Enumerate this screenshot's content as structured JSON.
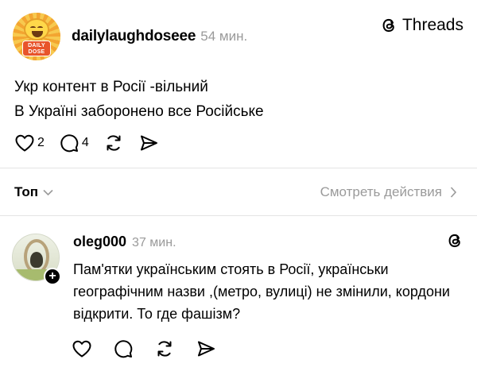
{
  "post": {
    "author": "dailylaughdoseee",
    "time": "54 мин.",
    "avatar_badge": "DAILY DOSE",
    "threads_label": "Threads",
    "text_lines": [
      "Укр контент в Росії -вільний",
      "В Україні заборонено все Російське"
    ],
    "likes": "2",
    "replies": "4"
  },
  "sort": {
    "label": "Топ",
    "view_activity": "Смотреть действия"
  },
  "reply": {
    "author": "oleg000",
    "time": "37 мин.",
    "plus": "+",
    "text": "Пам'ятки українським стоять в Росії, українськи географічним  назви ,(метро, вулиці) не змінили, кордони відкрити. То где фашізм?"
  },
  "icons": [
    "heart-icon",
    "comment-icon",
    "repost-icon",
    "share-icon",
    "threads-logo-icon",
    "chevron-down-icon",
    "chevron-right-icon"
  ],
  "colors": {
    "muted": "#9a9a9a",
    "divider": "#e4e4e4",
    "text": "#000000"
  }
}
